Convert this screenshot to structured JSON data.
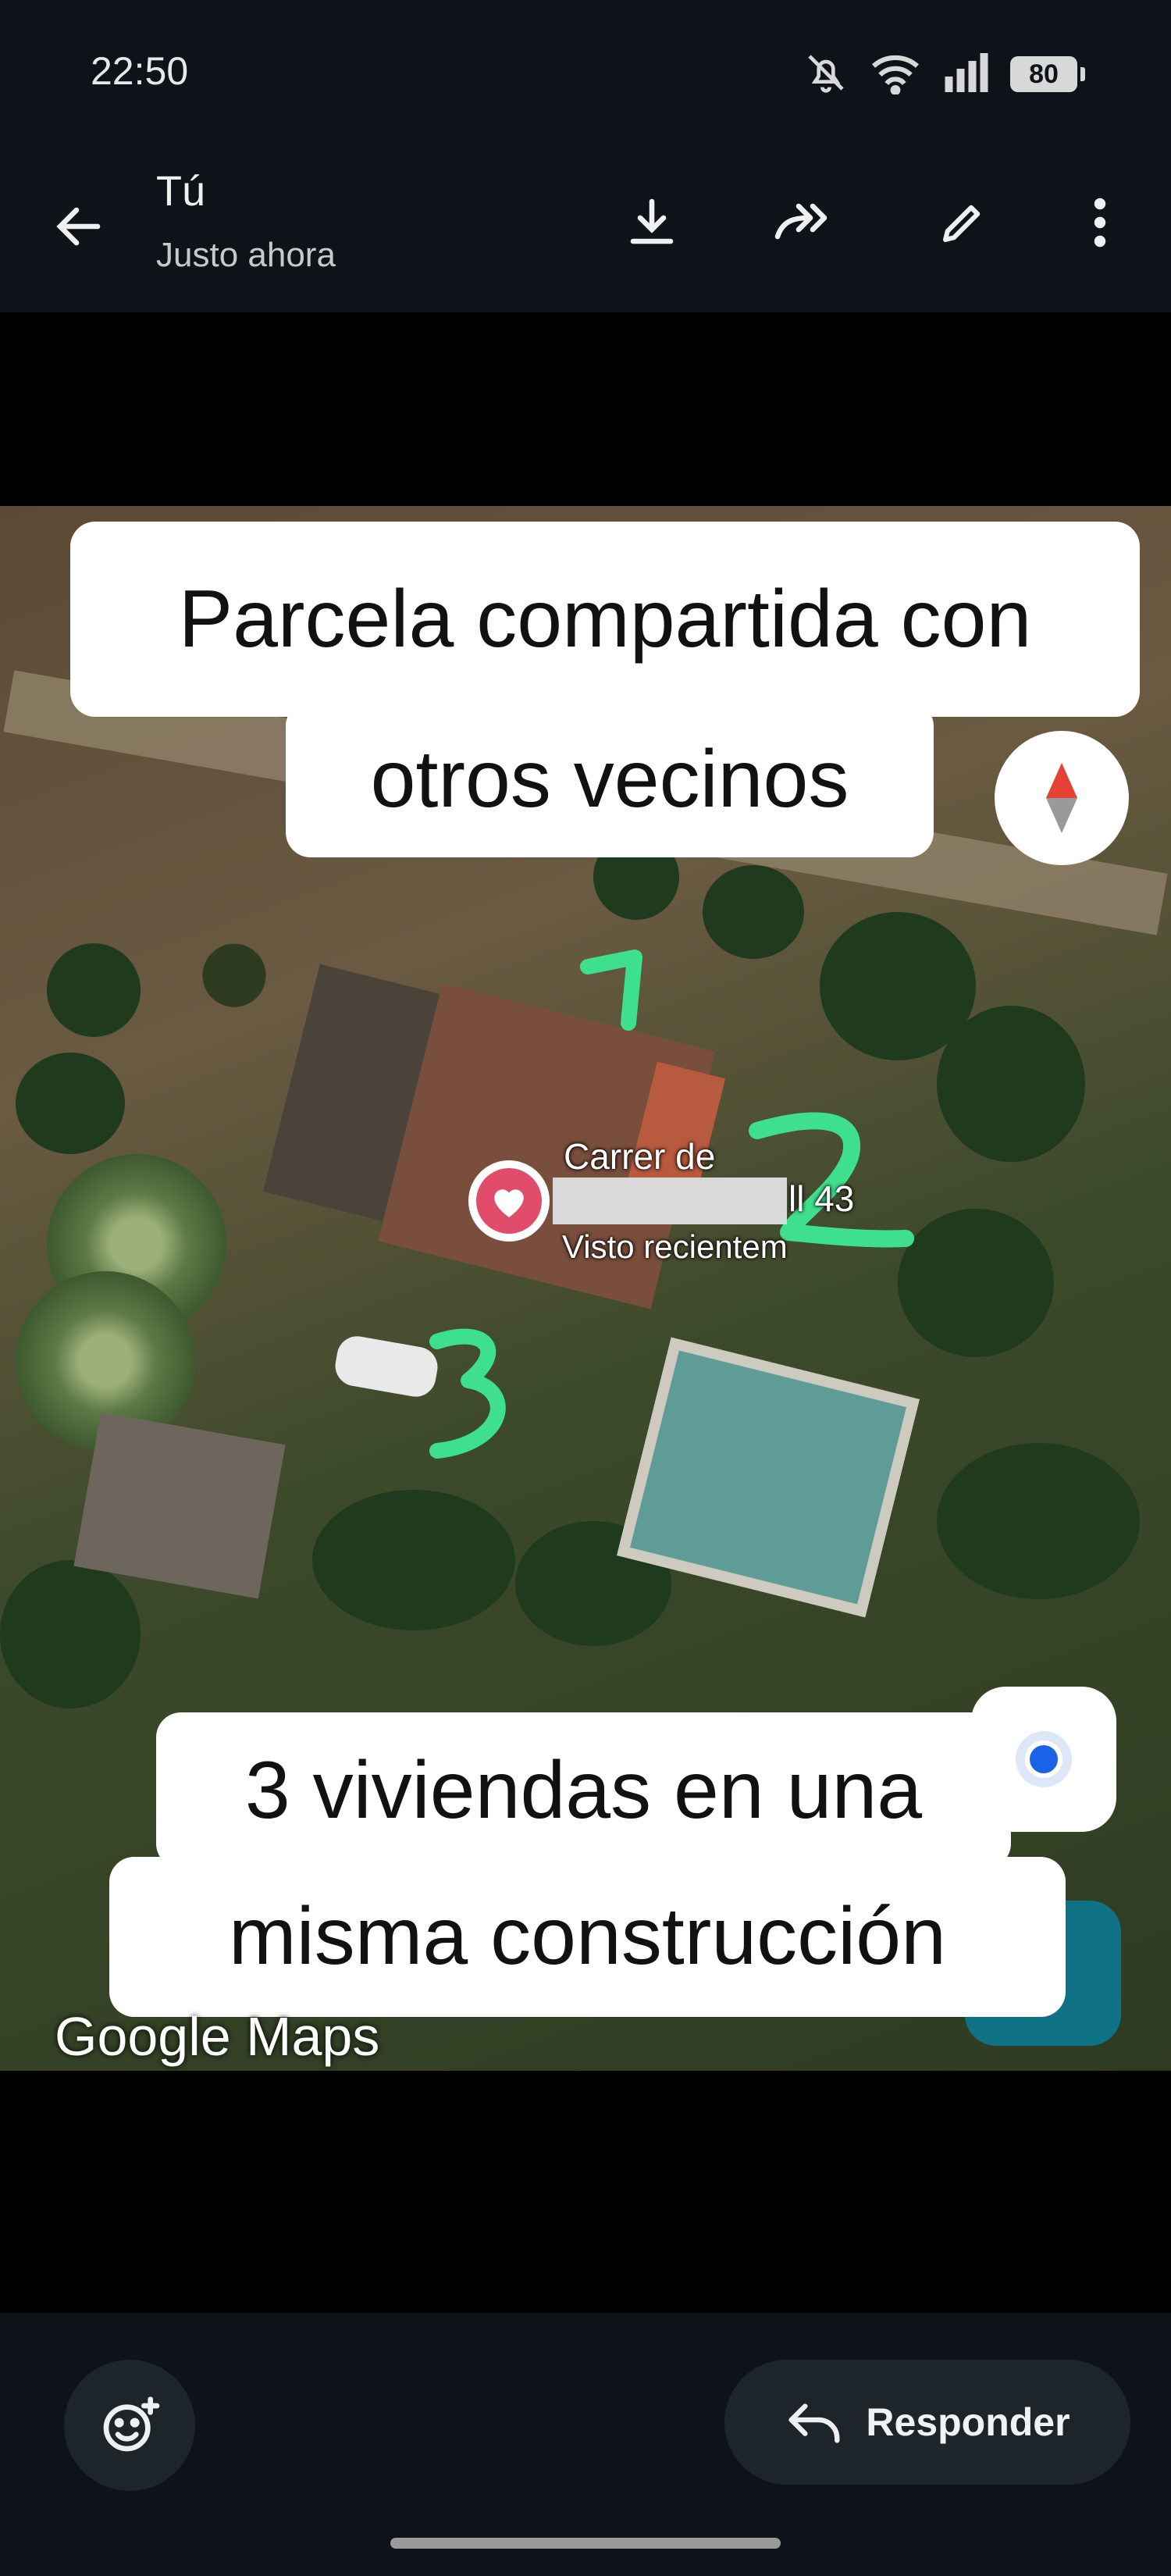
{
  "status_bar": {
    "time": "22:50",
    "battery": "80",
    "icons": [
      "mute-icon",
      "wifi-icon",
      "signal-icon",
      "battery-icon"
    ]
  },
  "header": {
    "sender": "Tú",
    "time_ago": "Justo ahora",
    "actions": [
      "back-arrow-icon",
      "download-icon",
      "forward-icon",
      "edit-icon",
      "more-vert-icon"
    ]
  },
  "image": {
    "caption_top_line1": "Parcela compartida con",
    "caption_top_line2": "otros vecinos",
    "caption_bottom_line1": "3 viviendas en una",
    "caption_bottom_line2": "misma construcción",
    "place_label_street": "Carrer de",
    "place_label_number": "ll 43",
    "place_label_sub": "Visto recientem",
    "watermark": "Google Maps",
    "annotation_numbers": [
      "1",
      "2",
      "3"
    ],
    "annotation_color": "#3ee08e"
  },
  "footer": {
    "reply_label": "Responder"
  }
}
